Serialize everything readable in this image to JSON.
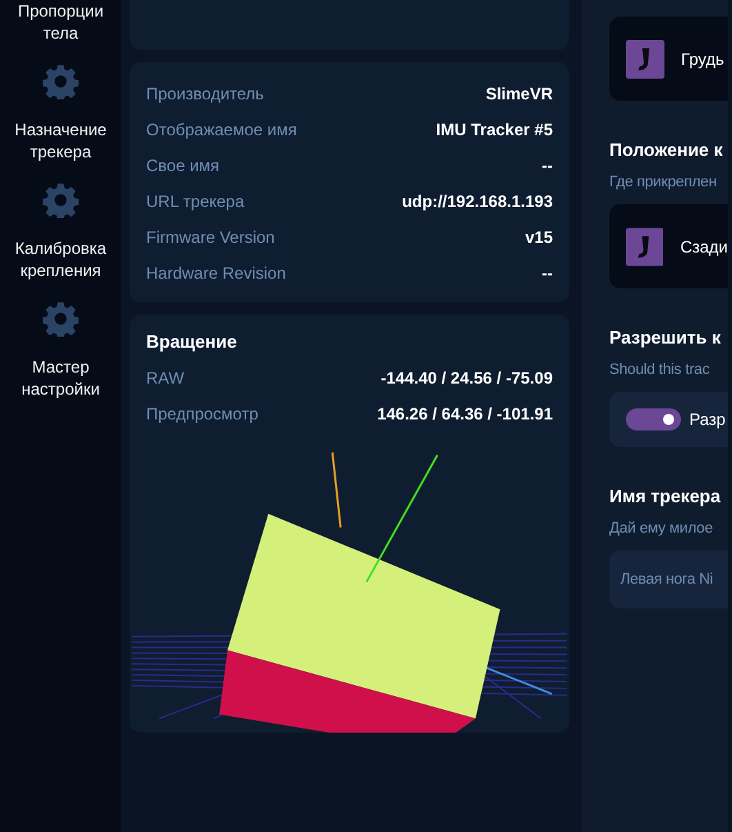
{
  "sidebar": {
    "items": [
      {
        "kind": "label-only",
        "label": "Пропорции тела"
      },
      {
        "kind": "nav",
        "label": "Назначение трекера"
      },
      {
        "kind": "nav",
        "label": "Калибровка крепления"
      },
      {
        "kind": "nav",
        "label": "Мастер настройки"
      }
    ]
  },
  "info": {
    "rows": [
      {
        "label": "Производитель",
        "value": "SlimeVR"
      },
      {
        "label": "Отображаемое имя",
        "value": "IMU Tracker #5"
      },
      {
        "label": "Свое имя",
        "value": "--"
      },
      {
        "label": "URL трекера",
        "value": "udp://192.168.1.193"
      },
      {
        "label": "Firmware Version",
        "value": "v15"
      },
      {
        "label": "Hardware Revision",
        "value": "--"
      }
    ]
  },
  "rotation": {
    "title": "Вращение",
    "rows": [
      {
        "label": "RAW",
        "value": "-144.40 / 24.56 / -75.09"
      },
      {
        "label": "Предпросмотр",
        "value": "146.26 / 64.36 / -101.91"
      }
    ]
  },
  "settings": {
    "body_part": {
      "label": "Грудь"
    },
    "sections": [
      {
        "kind": "select",
        "title": "Положение к",
        "hint": "Где прикреплен",
        "value": "Сзади"
      },
      {
        "kind": "toggle",
        "title": "Разрешить к",
        "hint": "Should this trac",
        "label": "Разр",
        "on": true
      },
      {
        "kind": "input",
        "title": "Имя трекера",
        "hint": "Дай ему милое",
        "placeholder": "Левая нога Ni"
      }
    ]
  }
}
